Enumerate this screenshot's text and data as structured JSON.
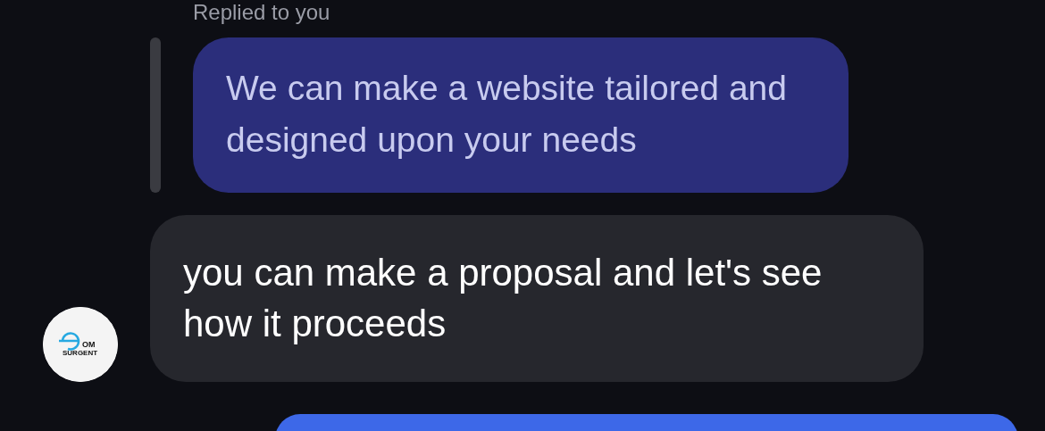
{
  "reply_label": "Replied to you",
  "messages": [
    {
      "kind": "quoted",
      "text": "We can make a website tailored and designed upon your needs"
    },
    {
      "kind": "received",
      "text": "you can make a proposal and let's see how it proceeds",
      "avatar": {
        "logo_lines": [
          "OM",
          "SURGENT"
        ]
      }
    },
    {
      "kind": "sent"
    }
  ]
}
